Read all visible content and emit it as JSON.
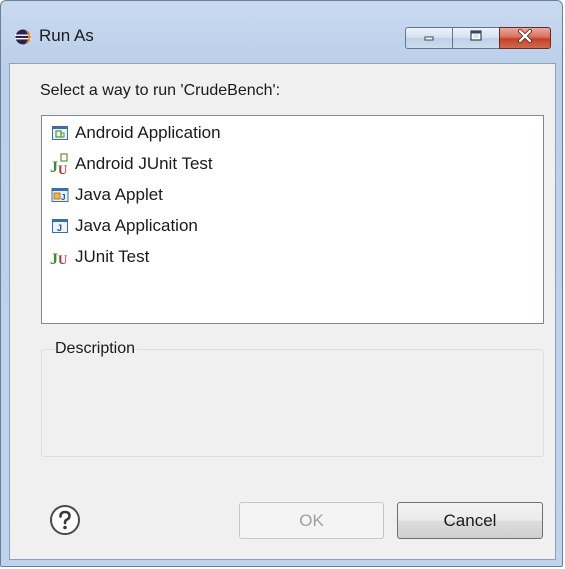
{
  "window": {
    "title": "Run As",
    "minimize_icon": "minimize-icon",
    "maximize_icon": "maximize-icon",
    "close_icon": "close-icon"
  },
  "dialog": {
    "prompt": "Select a way to run 'CrudeBench':",
    "launch_types": [
      {
        "label": "Android Application",
        "icon": "android-application-icon"
      },
      {
        "label": "Android JUnit Test",
        "icon": "android-junit-icon"
      },
      {
        "label": "Java Applet",
        "icon": "java-applet-icon"
      },
      {
        "label": "Java Application",
        "icon": "java-application-icon"
      },
      {
        "label": "JUnit Test",
        "icon": "junit-icon"
      }
    ],
    "description_label": "Description",
    "description_text": ""
  },
  "buttons": {
    "ok_label": "OK",
    "ok_enabled": false,
    "cancel_label": "Cancel",
    "help_icon": "help-icon"
  },
  "colors": {
    "title_bar": "#c9daf0",
    "close_button": "#c2412a",
    "client_background": "#f0f0f0"
  }
}
